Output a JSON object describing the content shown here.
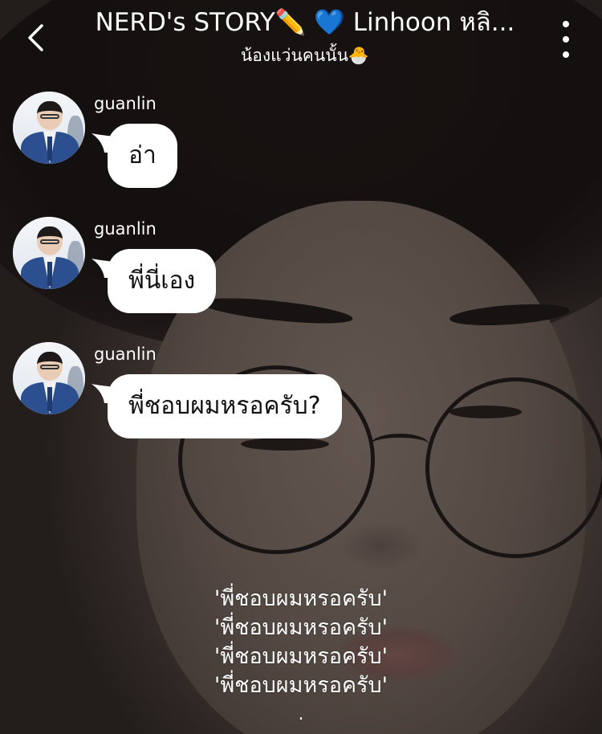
{
  "header": {
    "back_icon": "chevron-left-icon",
    "title": "NERD's STORY✏️ 💙 Linhoon หลิ...",
    "subtitle": "น้องแว่นคนนั้น🐣",
    "more_icon": "more-vertical-icon"
  },
  "messages": [
    {
      "sender": "guanlin",
      "text": "อ่า"
    },
    {
      "sender": "guanlin",
      "text": "พี่นี่เอง"
    },
    {
      "sender": "guanlin",
      "text": "พี่ชอบผมหรอครับ?"
    }
  ],
  "caption": {
    "lines": [
      "'พี่ชอบผมหรอครับ'",
      "'พี่ชอบผมหรอครับ'",
      "'พี่ชอบผมหรอครับ'",
      "'พี่ชอบผมหรอครับ'"
    ],
    "ellipsis": "."
  },
  "colors": {
    "bubble": "#ffffff",
    "bubble_text": "#111111",
    "header_text": "#ffffff"
  }
}
